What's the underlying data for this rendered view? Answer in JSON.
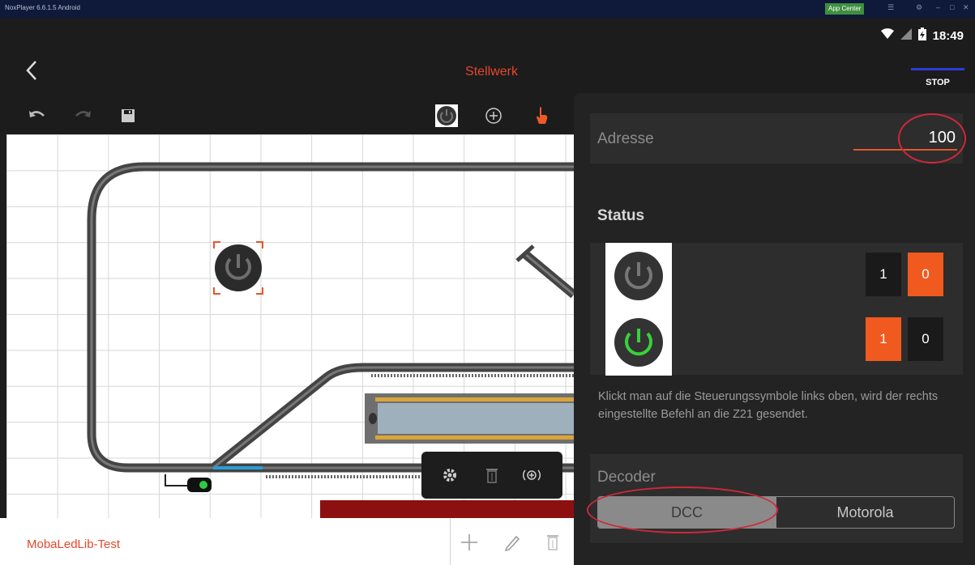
{
  "emulator": {
    "title": "NoxPlayer 6.6.1.5 Android",
    "app_center": "App Center"
  },
  "statusbar": {
    "time": "18:49"
  },
  "appbar": {
    "title": "Stellwerk",
    "stop_label": "STOP"
  },
  "layout": {
    "name": "MobaLedLib-Test"
  },
  "panel": {
    "address": {
      "label": "Adresse",
      "value": "100"
    },
    "status": {
      "title": "Status",
      "rows": [
        {
          "icon": "power-off-icon",
          "active": "0",
          "labels": [
            "1",
            "0"
          ]
        },
        {
          "icon": "power-on-icon",
          "active": "1",
          "labels": [
            "1",
            "0"
          ]
        }
      ]
    },
    "hint": "Klickt man auf die Steuerungssymbole links oben, wird der rechts eingestellte Befehl an die Z21 gesendet.",
    "decoder": {
      "label": "Decoder",
      "options": [
        "DCC",
        "Motorola"
      ],
      "selected": "DCC"
    }
  },
  "colors": {
    "accent": "#e4472a",
    "active_button": "#f05a1e",
    "annotation": "#d0283a",
    "stop_line": "#2c3cd6"
  }
}
